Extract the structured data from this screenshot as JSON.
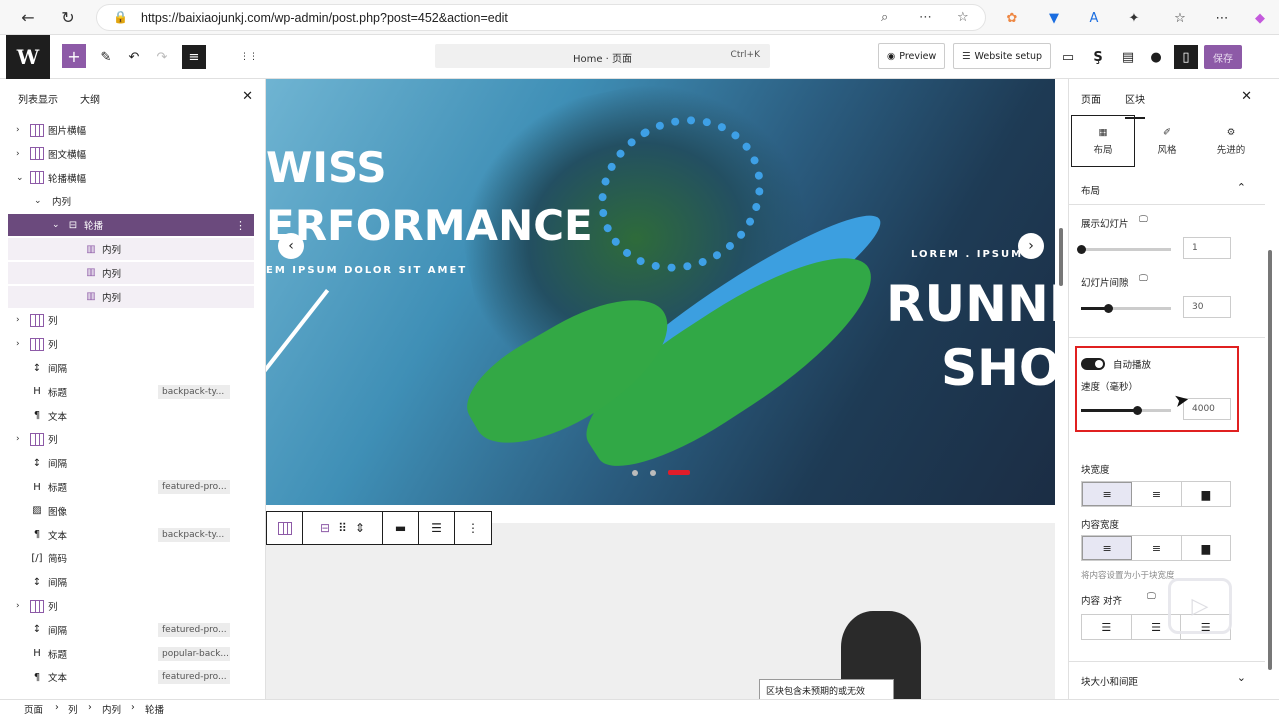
{
  "browser": {
    "url": "https://baixiaojunkj.com/wp-admin/post.php?post=452&action=edit"
  },
  "topbar": {
    "command": "Home · 页面",
    "shortcut": "Ctrl+K",
    "preview": "Preview",
    "website_setup": "Website setup",
    "save": "保存"
  },
  "left_panel": {
    "tab_list": "列表显示",
    "tab_outline": "大纲",
    "rows": [
      {
        "label": "图片横幅",
        "indent": 0,
        "caret": "›",
        "icon": "columns",
        "badge": ""
      },
      {
        "label": "图文横幅",
        "indent": 0,
        "caret": "›",
        "icon": "columns",
        "badge": ""
      },
      {
        "label": "轮播横幅",
        "indent": 0,
        "caret": "⌄",
        "icon": "columns",
        "badge": ""
      },
      {
        "label": "内列",
        "indent": 1,
        "caret": "⌄",
        "icon": "",
        "badge": ""
      },
      {
        "label": "轮播",
        "indent": 2,
        "caret": "⌄",
        "icon": "slider",
        "badge": "",
        "selected": true
      },
      {
        "label": "内列",
        "indent": 3,
        "caret": "",
        "icon": "column",
        "badge": "",
        "sub": true
      },
      {
        "label": "内列",
        "indent": 3,
        "caret": "",
        "icon": "column",
        "badge": "",
        "sub": true
      },
      {
        "label": "内列",
        "indent": 3,
        "caret": "",
        "icon": "column",
        "badge": "",
        "sub": true
      },
      {
        "label": "列",
        "indent": 0,
        "caret": "›",
        "icon": "columns",
        "badge": ""
      },
      {
        "label": "列",
        "indent": 0,
        "caret": "›",
        "icon": "columns",
        "badge": ""
      },
      {
        "label": "间隔",
        "indent": 0,
        "caret": "",
        "icon": "spacer",
        "badge": ""
      },
      {
        "label": "标题",
        "indent": 0,
        "caret": "",
        "icon": "heading",
        "badge": "backpack-ty..."
      },
      {
        "label": "文本",
        "indent": 0,
        "caret": "",
        "icon": "paragraph",
        "badge": ""
      },
      {
        "label": "列",
        "indent": 0,
        "caret": "›",
        "icon": "columns",
        "badge": ""
      },
      {
        "label": "间隔",
        "indent": 0,
        "caret": "",
        "icon": "spacer",
        "badge": ""
      },
      {
        "label": "标题",
        "indent": 0,
        "caret": "",
        "icon": "heading",
        "badge": "featured-pro..."
      },
      {
        "label": "图像",
        "indent": 0,
        "caret": "",
        "icon": "image",
        "badge": ""
      },
      {
        "label": "文本",
        "indent": 0,
        "caret": "",
        "icon": "paragraph",
        "badge": "backpack-ty..."
      },
      {
        "label": "简码",
        "indent": 0,
        "caret": "",
        "icon": "shortcode",
        "badge": ""
      },
      {
        "label": "间隔",
        "indent": 0,
        "caret": "",
        "icon": "spacer",
        "badge": ""
      },
      {
        "label": "列",
        "indent": 0,
        "caret": "›",
        "icon": "columns",
        "badge": ""
      },
      {
        "label": "间隔",
        "indent": 0,
        "caret": "",
        "icon": "spacer",
        "badge": "featured-pro..."
      },
      {
        "label": "标题",
        "indent": 0,
        "caret": "",
        "icon": "heading",
        "badge": "popular-back..."
      },
      {
        "label": "文本",
        "indent": 0,
        "caret": "",
        "icon": "paragraph",
        "badge": "featured-pro..."
      }
    ]
  },
  "canvas": {
    "hero_left_1": "WISS",
    "hero_left_2": "ERFORMANCE",
    "hero_left_3": "EM IPSUM DOLOR SIT AMET",
    "hero_right_1": "LOREM . IPSUM",
    "hero_right_2": "RUNNING",
    "hero_right_3": "SHOE",
    "tooltip": "区块包含未预期的或无效"
  },
  "right_panel": {
    "tab_page": "页面",
    "tab_block": "区块",
    "sub_layout": "布局",
    "sub_style": "风格",
    "sub_advanced": "先进的",
    "section_layout": "布局",
    "slides_label": "展示幻灯片",
    "slides_value": "1",
    "slides_fraction": 0.0,
    "gap_label": "幻灯片间隙",
    "gap_value": "30",
    "gap_fraction": 0.3,
    "autoplay_label": "自动播放",
    "speed_label": "速度（毫秒）",
    "speed_value": "4000",
    "speed_fraction": 0.62,
    "block_width_label": "块宽度",
    "content_width_label": "内容宽度",
    "content_width_hint": "将内容设置为小于块宽度",
    "content_align_label": "内容 对齐",
    "size_spacing_label": "块大小和间距"
  },
  "breadcrumb": [
    "页面",
    "列",
    "内列",
    "轮播"
  ],
  "colors": {
    "accent": "#8d5aa7",
    "selected_row": "#6b4a7d",
    "highlight_box": "#e02020",
    "slider_dot_active": "#e11d2a"
  }
}
